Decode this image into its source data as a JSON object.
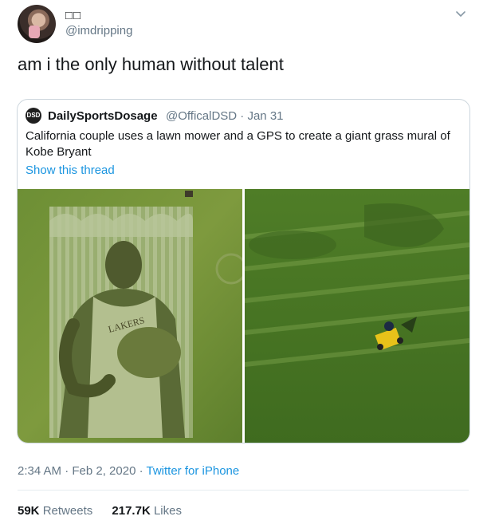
{
  "tweet": {
    "display_name": "□□",
    "handle": "@imdripping",
    "text": "am i the only human without talent",
    "timestamp": "2:34 AM · Feb 2, 2020",
    "separator": " · ",
    "source": "Twitter for iPhone",
    "retweets_count": "59K",
    "retweets_label": "Retweets",
    "likes_count": "217.7K",
    "likes_label": "Likes"
  },
  "quoted": {
    "avatar_text": "DSD",
    "name": "DailySportsDosage",
    "meta": "@OfficalDSD · Jan 31",
    "text": "California couple uses a lawn mower and a GPS to create a giant grass mural of Kobe Bryant",
    "thread_link": "Show this thread",
    "jersey_text": "LAKERS"
  },
  "icons": {
    "menu": "chevron-down-icon"
  },
  "colors": {
    "link": "#1b95e0",
    "secondary_text": "#657786",
    "primary_text": "#14171a",
    "border": "#ccd6dd",
    "grass": "#5f8a2e"
  }
}
